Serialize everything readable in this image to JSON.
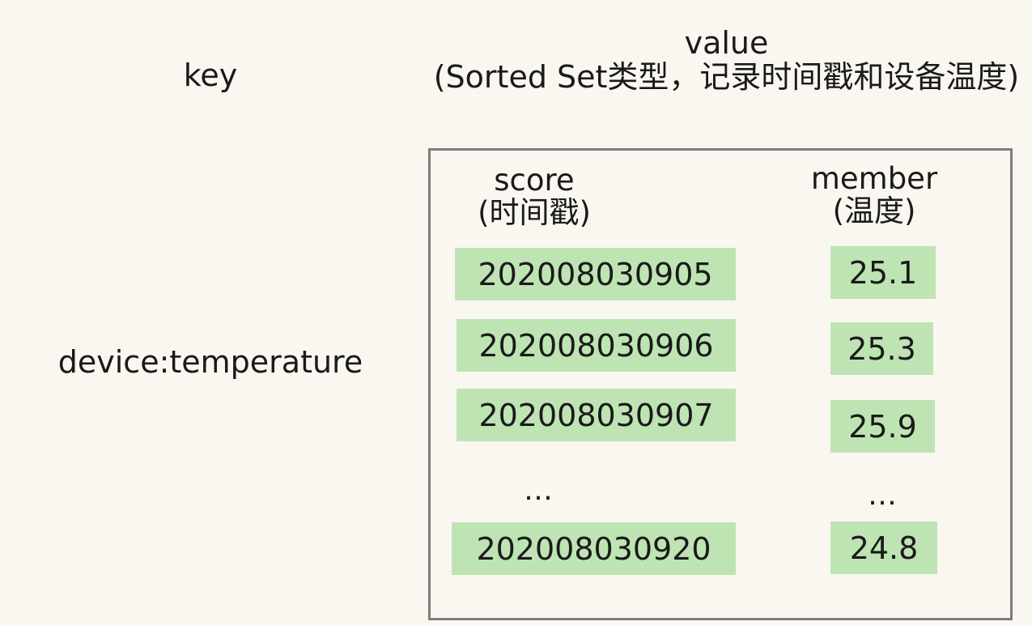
{
  "header": {
    "key_label": "key",
    "value_label": "value",
    "value_sublabel": "(Sorted Set类型，记录时间戳和设备温度)"
  },
  "key_name": "device:temperature",
  "columns": {
    "score_label": "score",
    "score_sublabel": "(时间戳)",
    "member_label": "member",
    "member_sublabel": "(温度)"
  },
  "rows": [
    {
      "score": "202008030905",
      "member": "25.1"
    },
    {
      "score": "202008030906",
      "member": "25.3"
    },
    {
      "score": "202008030907",
      "member": "25.9"
    },
    {
      "score": "202008030920",
      "member": "24.8"
    }
  ],
  "ellipsis": {
    "score": "…",
    "member": "…"
  },
  "colors": {
    "background": "#f9f7ef",
    "cell_fill": "#bfe4b3",
    "frame_border": "#7d7d7d"
  }
}
